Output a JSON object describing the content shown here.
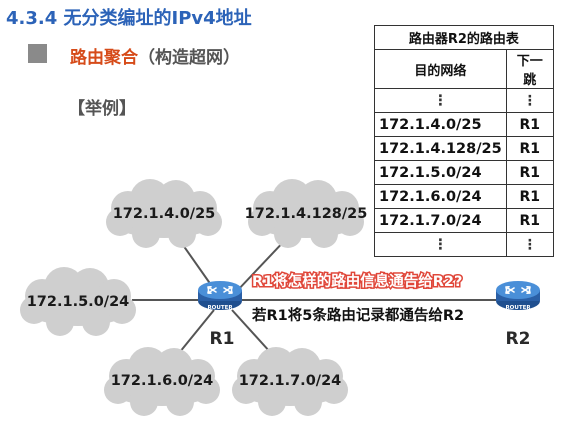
{
  "title": "4.3.4 无分类编址的IPv4地址",
  "heading": {
    "main": "路由聚合",
    "sub": "（构造超网）"
  },
  "example_label": "【举例】",
  "routing_table": {
    "caption": "路由器R2的路由表",
    "col_dest": "目的网络",
    "col_hop": "下一跳",
    "rows": [
      {
        "dest": "⋮",
        "hop": "⋮"
      },
      {
        "dest": "172.1.4.0/25",
        "hop": "R1"
      },
      {
        "dest": "172.1.4.128/25",
        "hop": "R1"
      },
      {
        "dest": "172.1.5.0/24",
        "hop": "R1"
      },
      {
        "dest": "172.1.6.0/24",
        "hop": "R1"
      },
      {
        "dest": "172.1.7.0/24",
        "hop": "R1"
      },
      {
        "dest": "⋮",
        "hop": "⋮"
      }
    ]
  },
  "networks": {
    "n1": "172.1.4.0/25",
    "n2": "172.1.4.128/25",
    "n3": "172.1.5.0/24",
    "n4": "172.1.6.0/24",
    "n5": "172.1.7.0/24"
  },
  "routers": {
    "r1": "R1",
    "r2": "R2",
    "icon_caption": "ROUTER"
  },
  "question": "R1将怎样的路由信息通告给R2?",
  "statement": "若R1将5条路由记录都通告给R2",
  "colors": {
    "title": "#2c63b8",
    "accent": "#d64b19",
    "router": "#2f6fc0",
    "question": "#e0473a"
  }
}
